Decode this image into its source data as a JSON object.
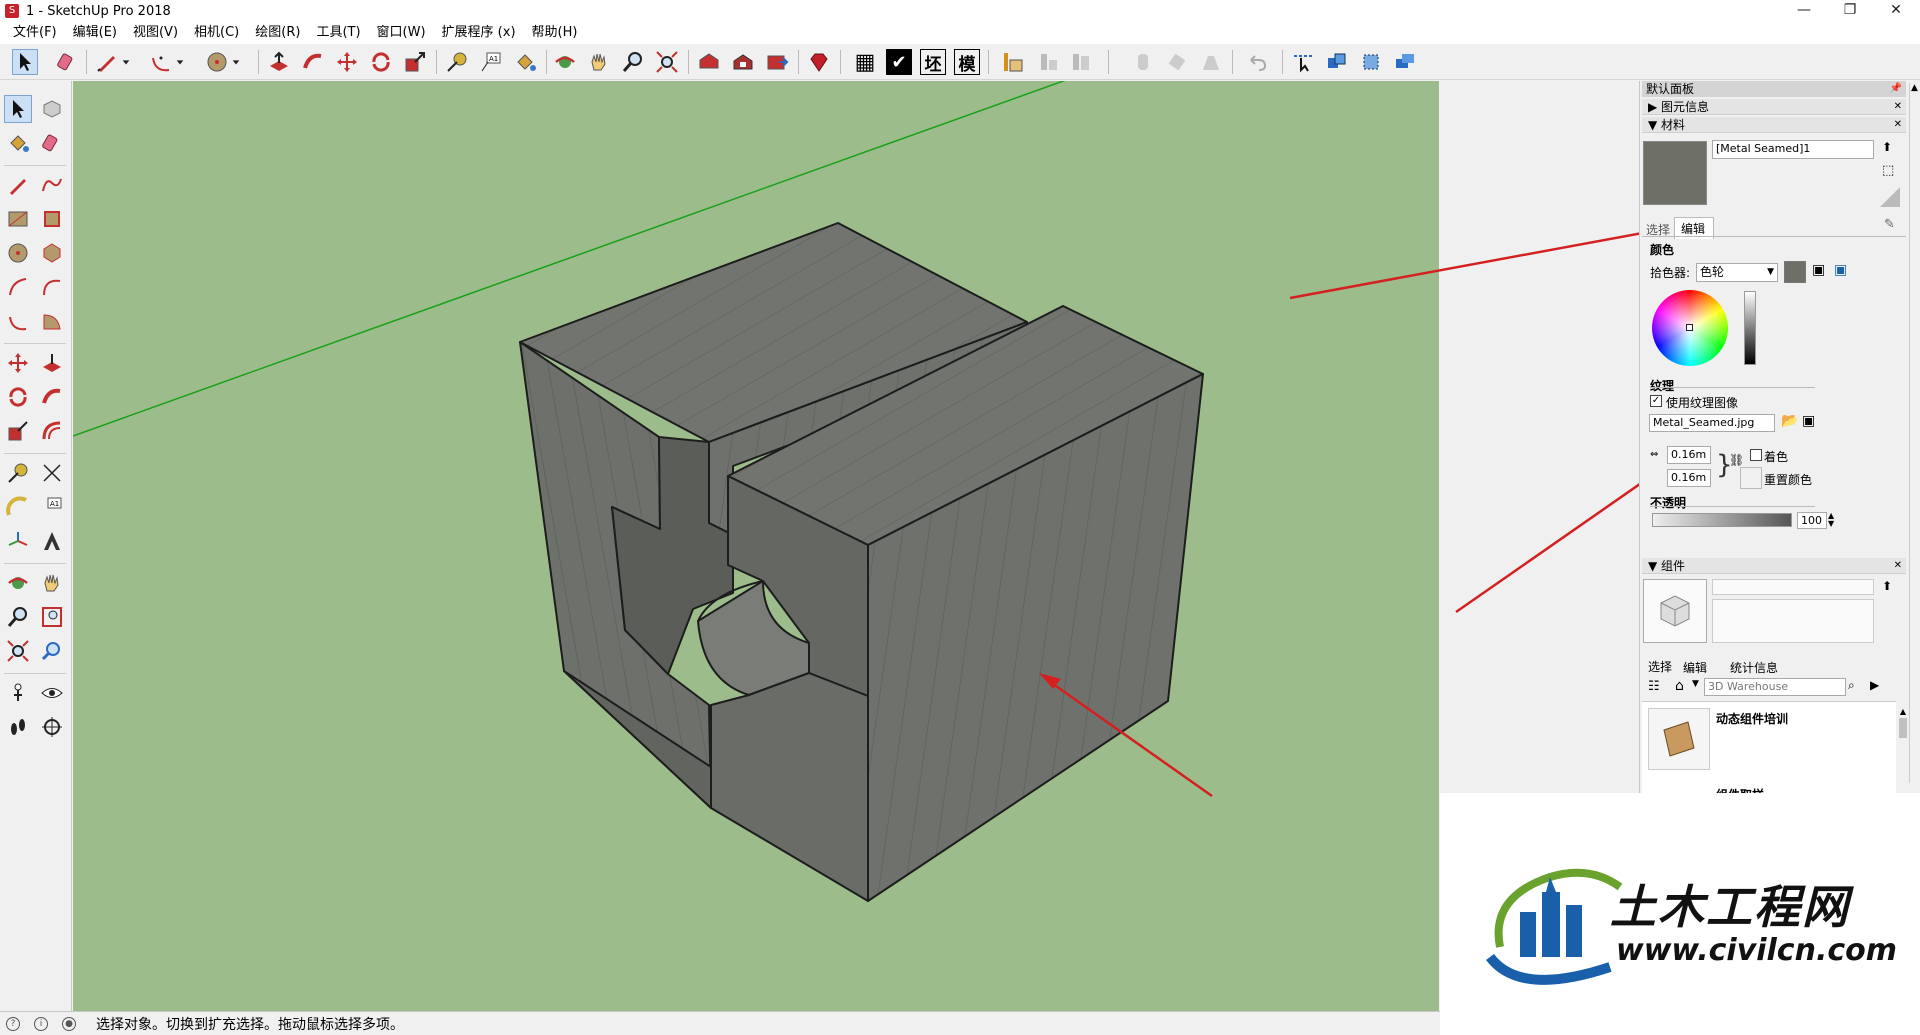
{
  "window": {
    "title": "1 - SketchUp Pro 2018",
    "minimize": "—",
    "restore": "❐",
    "close": "✕"
  },
  "menu": [
    "文件(F)",
    "编辑(E)",
    "视图(V)",
    "相机(C)",
    "绘图(R)",
    "工具(T)",
    "窗口(W)",
    "扩展程序 (x)",
    "帮助(H)"
  ],
  "toolbar": {
    "icons": [
      "select-icon",
      "eraser-icon",
      "pencil-icon",
      "arc-icon",
      "circle-icon",
      "push-pull-icon",
      "follow-me-icon",
      "move-icon",
      "rotate-icon",
      "scale-icon",
      "tape-measure-icon",
      "text-icon",
      "paint-bucket-icon",
      "orbit-icon",
      "pan-icon",
      "zoom-icon",
      "zoom-extents-icon",
      "warehouse-icon",
      "share-model-icon",
      "extension-warehouse-icon",
      "ruby-icon"
    ],
    "table_glyph": "▦",
    "check_glyph": "✔",
    "label_1": "坯",
    "label_2": "模"
  },
  "status": {
    "text": "选择对象。切换到扩充选择。拖动鼠标选择多项。"
  },
  "tray": {
    "title": "默认面板",
    "entity_info": "图元信息",
    "materials": {
      "header": "材料",
      "name": "[Metal Seamed]1",
      "tab_select": "选择",
      "tab_edit": "编辑",
      "color_section": "颜色",
      "picker_label": "拾色器:",
      "picker_value": "色轮",
      "texture_section": "纹理",
      "use_texture_label": "使用纹理图像",
      "use_texture_checked": "✓",
      "texture_file": "Metal_Seamed.jpg",
      "width": "0.16m",
      "height": "0.16m",
      "colorize_label": "着色",
      "reset_color_label": "重置颜色",
      "opacity_section": "不透明",
      "opacity_value": "100",
      "sample_color": "#6e7068"
    },
    "components": {
      "header": "组件",
      "tab_select": "选择",
      "tab_edit": "编辑",
      "tab_stats": "统计信息",
      "search_placeholder": "3D Warehouse",
      "item_1": "动态组件培训",
      "item_2": "组件取样"
    }
  },
  "watermark": {
    "brand": "土木工程网",
    "url": "www.civilcn.com"
  },
  "colors": {
    "viewport_bg": "#9cbd8b",
    "arrow": "#d42020",
    "model_face": "#6f716c",
    "brand_blue": "#1a5faa",
    "brand_green": "#6aa22e"
  }
}
